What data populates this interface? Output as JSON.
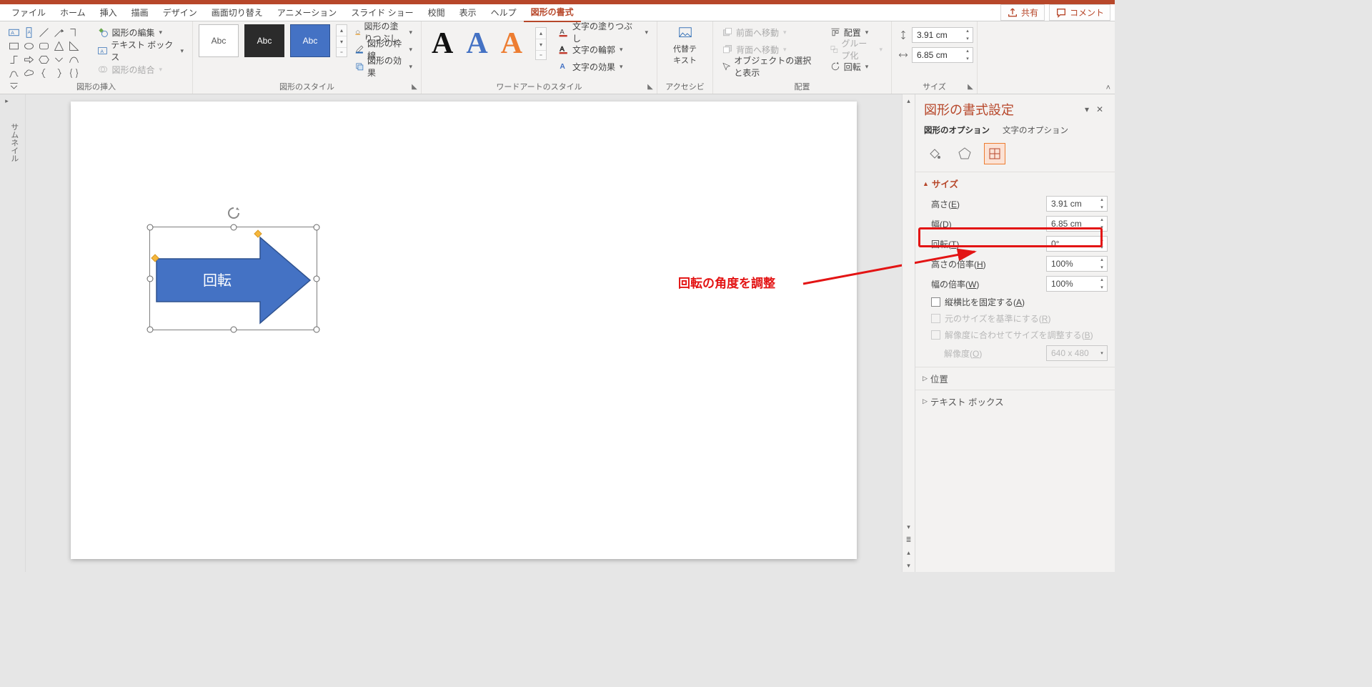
{
  "tabs": {
    "file": "ファイル",
    "home": "ホーム",
    "insert": "挿入",
    "draw": "描画",
    "design": "デザイン",
    "transition": "画面切り替え",
    "animation": "アニメーション",
    "slideshow": "スライド ショー",
    "review": "校閲",
    "view": "表示",
    "help": "ヘルプ",
    "shape_format": "図形の書式"
  },
  "top_right": {
    "share": "共有",
    "comment": "コメント"
  },
  "ribbon": {
    "insert_shapes": {
      "edit_shape": "図形の編集",
      "text_box": "テキスト ボックス",
      "merge": "図形の結合",
      "label": "図形の挿入"
    },
    "styles": {
      "sample": "Abc",
      "fill": "図形の塗りつぶし",
      "outline": "図形の枠線",
      "effects": "図形の効果",
      "label": "図形のスタイル"
    },
    "wordart": {
      "fill": "文字の塗りつぶし",
      "outline": "文字の輪郭",
      "effects": "文字の効果",
      "label": "ワードアートのスタイル"
    },
    "access": {
      "alt": "代替テ\nキスト",
      "label": "アクセシビリティ"
    },
    "arrange": {
      "front": "前面へ移動",
      "back": "背面へ移動",
      "select": "オブジェクトの選択と表示",
      "align": "配置",
      "group": "グループ化",
      "rotate": "回転",
      "label": "配置"
    },
    "size": {
      "label": "サイズ",
      "h": "3.91 cm",
      "w": "6.85 cm"
    }
  },
  "rail": {
    "thumb": "サムネイル"
  },
  "slide": {
    "shape_text": "回転"
  },
  "annotation": {
    "text": "回転の角度を調整"
  },
  "pane": {
    "title": "図形の書式設定",
    "opt_shape": "図形のオプション",
    "opt_text": "文字のオプション",
    "sec_size": "サイズ",
    "height_l": "高さ(",
    "height_k": "E",
    "height_r": ")",
    "height_v": "3.91 cm",
    "width_l": "幅(",
    "width_k": "D",
    "width_r": ")",
    "width_v": "6.85 cm",
    "rot_l": "回転(",
    "rot_k": "T",
    "rot_r": ")",
    "rot_v": "0°",
    "sh_l": "高さの倍率(",
    "sh_k": "H",
    "sh_r": ")",
    "sh_v": "100%",
    "sw_l": "幅の倍率(",
    "sw_k": "W",
    "sw_r": ")",
    "sw_v": "100%",
    "lock_l": "縦横比を固定する(",
    "lock_k": "A",
    "lock_r": ")",
    "orig_l": "元のサイズを基準にする(",
    "orig_k": "R",
    "orig_r": ")",
    "res_l": "解像度に合わせてサイズを調整する(",
    "res_k": "B",
    "res_r": ")",
    "reso_l": "解像度(",
    "reso_k": "O",
    "reso_r": ")",
    "reso_v": "640 x 480",
    "sec_pos": "位置",
    "sec_tb": "テキスト ボックス"
  }
}
